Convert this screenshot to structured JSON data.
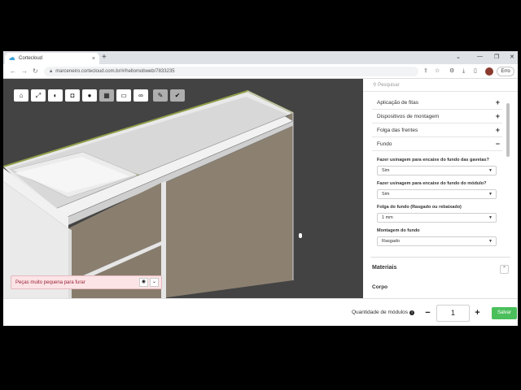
{
  "browser": {
    "tab_title": "Cortecloud",
    "tab_close": "×",
    "new_tab": "+",
    "window_controls": [
      "⌄",
      "—",
      "❐",
      "✕"
    ],
    "url": "marceneiro.cortecloud.com.br/#/hellomobweb/7833235",
    "profile_label": "Erro"
  },
  "toolbar": {
    "tools": [
      {
        "name": "home-icon",
        "glyph": "⌂"
      },
      {
        "name": "fullscreen-icon",
        "glyph": "⤢"
      },
      {
        "name": "contrast-icon",
        "glyph": "◐"
      },
      {
        "name": "camera-icon",
        "glyph": "◘"
      },
      {
        "name": "location-pin-icon",
        "glyph": "●"
      },
      {
        "name": "grid-icon",
        "glyph": "▦"
      },
      {
        "name": "tray-icon",
        "glyph": "▭"
      },
      {
        "name": "glasses-icon",
        "glyph": "∞"
      },
      {
        "name": "pencil-icon",
        "glyph": "✎"
      },
      {
        "name": "check-icon",
        "glyph": "✔"
      }
    ]
  },
  "warning": {
    "text": "Peças muito pequena para furar",
    "eye_glyph": "◉",
    "chevron_glyph": "⌄"
  },
  "panel": {
    "search_placeholder": "Pesquisar",
    "sections": [
      {
        "label": "Aplicação de fitas",
        "sign": "+"
      },
      {
        "label": "Dispositivos de montagem",
        "sign": "+"
      },
      {
        "label": "Folga das frentes",
        "sign": "+"
      },
      {
        "label": "Fundo",
        "sign": "−"
      }
    ],
    "fields": [
      {
        "label": "Fazer usinagem para encaixe do fundo das gavetas?",
        "value": "Sim"
      },
      {
        "label": "Fazer usinagem para encaixe do fundo do módulo?",
        "value": "Sim"
      },
      {
        "label": "Folga do fundo (Rasgado ou rebaixado)",
        "value": "1 mm"
      },
      {
        "label": "Montagem do fundo",
        "value": "Rasgado"
      }
    ],
    "materials_title": "Materiais",
    "materials_toggle": "⌃",
    "corpo_label": "Corpo"
  },
  "bottom": {
    "quantity_label": "Quantidade de módulos",
    "quantity_info": "i",
    "minus": "−",
    "quantity_value": "1",
    "plus": "+",
    "save_label": "Salvar"
  },
  "colors": {
    "viewport_bg": "#434343",
    "save_green": "#4bbf5c",
    "warning_bg": "#fbe3e6",
    "warning_text": "#9b2335"
  }
}
